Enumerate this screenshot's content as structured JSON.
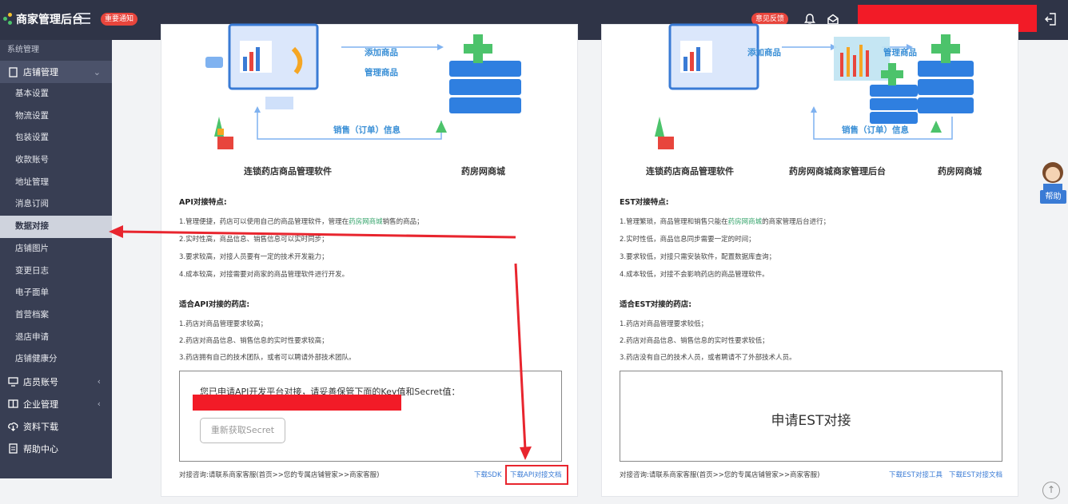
{
  "header": {
    "title": "商家管理后台",
    "notice_label": "重要通知",
    "feedback_label": "意见反馈"
  },
  "sidebar": {
    "section_label": "系统管理",
    "store_group": "店铺管理",
    "items": [
      "基本设置",
      "物流设置",
      "包装设置",
      "收款账号",
      "地址管理",
      "消息订阅",
      "数据对接",
      "店铺图片",
      "变更日志",
      "电子面单",
      "首营档案",
      "退店申请",
      "店铺健康分"
    ],
    "active_item": "数据对接",
    "other_groups": [
      "店员账号",
      "企业管理",
      "资料下载",
      "帮助中心"
    ]
  },
  "left_panel": {
    "diagram": {
      "software_label": "连锁药店商品管理软件",
      "mall_label": "药房网商城",
      "flow_add": "添加商品",
      "flow_manage": "管理商品",
      "flow_sales": "销售（订单）信息"
    },
    "features_title": "API对接特点:",
    "features": [
      {
        "pre": "1.管理便捷，药店可以使用自己的商品管理软件，管理在",
        "hl": "药房网商城",
        "post": "销售的商品；"
      },
      {
        "pre": "2.实时性高，商品信息、销售信息可以实时同步；",
        "hl": "",
        "post": ""
      },
      {
        "pre": "3.要求较高，对接人员要有一定的技术开发能力；",
        "hl": "",
        "post": ""
      },
      {
        "pre": "4.成本较高，对接需要对商家的商品管理软件进行开发。",
        "hl": "",
        "post": ""
      }
    ],
    "suitable_title": "适合API对接的药店:",
    "suitable": [
      "1.药店对商品管理要求较高；",
      "2.药店对商品信息、销售信息的实时性要求较高；",
      "3.药店拥有自己的技术团队，或者可以聘请外部技术团队。"
    ],
    "box_text": "您已申请API开发平台对接，请妥善保管下面的Key值和Secret值：",
    "regen_button": "重新获取Secret",
    "footer_note": "对接咨询:请联系商家客服(首页>>您的专属店铺管家>>商家客服)",
    "link_sdk": "下载SDK",
    "link_doc": "下载API对接文档"
  },
  "right_panel": {
    "diagram": {
      "software_label": "连锁药店商品管理软件",
      "backend_label": "药房网商城商家管理后台",
      "mall_label": "药房网商城",
      "flow_add": "添加商品",
      "flow_manage": "管理商品",
      "flow_sales": "销售（订单）信息"
    },
    "features_title": "EST对接特点:",
    "features": [
      {
        "pre": "1.管理繁琐，商品管理和销售只能在",
        "hl": "药房网商城",
        "post": "的商家管理后台进行；"
      },
      {
        "pre": "2.实时性低，商品信息同步需要一定的时间；",
        "hl": "",
        "post": ""
      },
      {
        "pre": "3.要求较低，对接只需安装软件，配置数据库查询；",
        "hl": "",
        "post": ""
      },
      {
        "pre": "4.成本较低，对接不会影响药店的商品管理软件。",
        "hl": "",
        "post": ""
      }
    ],
    "suitable_title": "适合EST对接的药店:",
    "suitable": [
      "1.药店对商品管理要求较低；",
      "2.药店对商品信息、销售信息的实时性要求较低；",
      "3.药店没有自己的技术人员，或者聘请不了外部技术人员。"
    ],
    "box_text": "申请EST对接",
    "footer_note": "对接咨询:请联系商家客服(首页>>您的专属店铺管家>>商家客服)",
    "link_tool": "下载EST对接工具",
    "link_doc": "下载EST对接文档"
  },
  "help_widget": {
    "label": "帮助"
  },
  "colors": {
    "topbar": "#2f3447",
    "sidebar": "#383e53",
    "accent_red": "#e8252e",
    "link": "#3a7bd5",
    "highlight": "#33a36a"
  }
}
